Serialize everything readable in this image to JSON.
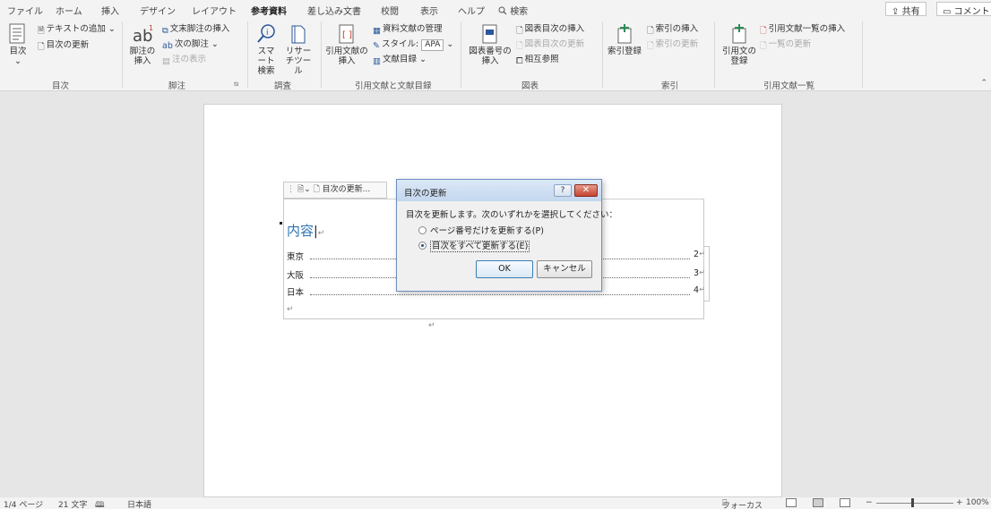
{
  "tabs": [
    "ファイル",
    "ホーム",
    "挿入",
    "デザイン",
    "レイアウト",
    "参考資料",
    "差し込み文書",
    "校閲",
    "表示",
    "ヘルプ"
  ],
  "search_tab": "検索",
  "share": "共有",
  "comment": "コメント",
  "ribbon": {
    "toc": {
      "label": "目次",
      "add_text": "テキストの追加",
      "update_toc": "目次の更新",
      "group": "目次"
    },
    "footnote": {
      "insert": "脚注の挿入",
      "insert_endnote": "文末脚注の挿入",
      "next": "次の脚注",
      "show": "注の表示",
      "group": "脚注"
    },
    "research": {
      "smart": "スマート検索",
      "researcher": "リサーチツール",
      "group": "調査"
    },
    "citation": {
      "insert": "引用文献の挿入",
      "manage": "資料文献の管理",
      "style_label": "スタイル:",
      "style_value": "APA",
      "bibliography": "文献目録",
      "group": "引用文献と文献目録"
    },
    "caption": {
      "insert": "図表番号の挿入",
      "insert_tof": "図表目次の挿入",
      "update_tof": "図表目次の更新",
      "cross_ref": "相互参照",
      "group": "図表"
    },
    "index": {
      "mark": "索引登録",
      "insert": "索引の挿入",
      "update": "索引の更新",
      "group": "索引"
    },
    "authorities": {
      "mark": "引用文の登録",
      "insert": "引用文献一覧の挿入",
      "update": "一覧の更新",
      "group": "引用文献一覧"
    }
  },
  "document": {
    "toc_bar_label": "目次の更新...",
    "toc_title": "内容",
    "entries": [
      {
        "name": "東京",
        "page": "2"
      },
      {
        "name": "大阪",
        "page": "3"
      },
      {
        "name": "日本",
        "page": "4"
      }
    ]
  },
  "dialog": {
    "title": "目次の更新",
    "help": "?",
    "close": "✕",
    "prompt": "目次を更新します。次のいずれかを選択してください：",
    "option_page_only": "ページ番号だけを更新する(P)",
    "option_entire": "目次をすべて更新する(E)",
    "selected": "entire",
    "ok": "OK",
    "cancel": "キャンセル"
  },
  "status": {
    "page": "1/4 ページ",
    "words": "21 文字",
    "language": "日本語",
    "focus": "フォーカス",
    "zoom": "100%",
    "zoom_minus": "−",
    "zoom_plus": "+"
  }
}
